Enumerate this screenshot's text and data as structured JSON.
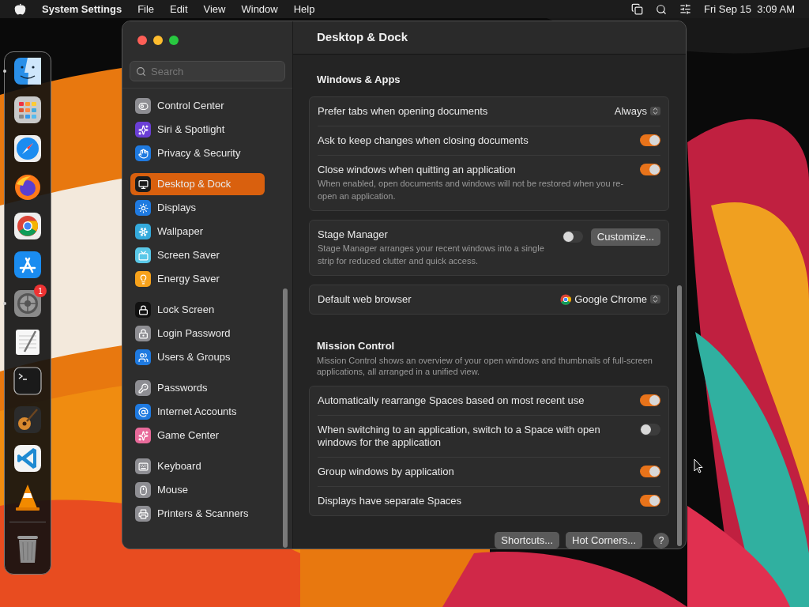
{
  "menubar": {
    "app_name": "System Settings",
    "menus": [
      "File",
      "Edit",
      "View",
      "Window",
      "Help"
    ],
    "clock": "Fri Sep 15  3:09 AM"
  },
  "dock": {
    "items": [
      {
        "kind": "finder",
        "running": true
      },
      {
        "kind": "launchpad",
        "running": false
      },
      {
        "kind": "safari",
        "running": false
      },
      {
        "kind": "firefox",
        "running": false
      },
      {
        "kind": "chrome",
        "running": false
      },
      {
        "kind": "appstore",
        "running": false
      },
      {
        "kind": "settings",
        "running": true,
        "badge": "1"
      },
      {
        "kind": "textedit",
        "running": false
      },
      {
        "kind": "terminal",
        "running": false
      },
      {
        "kind": "guitar",
        "running": false
      },
      {
        "kind": "vscode",
        "running": false
      },
      {
        "kind": "vlc",
        "running": false
      },
      {
        "kind": "trash",
        "running": false
      }
    ]
  },
  "sidebar": {
    "search": {
      "placeholder": "Search"
    },
    "groups": [
      [
        {
          "label": "Control Center",
          "kind": "controls",
          "selected": false
        },
        {
          "label": "Siri & Spotlight",
          "kind": "siri",
          "selected": false
        },
        {
          "label": "Privacy & Security",
          "kind": "privacy",
          "selected": false
        }
      ],
      [
        {
          "label": "Desktop & Dock",
          "kind": "desktop",
          "selected": true
        },
        {
          "label": "Displays",
          "kind": "displays",
          "selected": false
        },
        {
          "label": "Wallpaper",
          "kind": "wallpaper",
          "selected": false
        },
        {
          "label": "Screen Saver",
          "kind": "screensaver",
          "selected": false
        },
        {
          "label": "Energy Saver",
          "kind": "energy",
          "selected": false
        }
      ],
      [
        {
          "label": "Lock Screen",
          "kind": "lock",
          "selected": false
        },
        {
          "label": "Login Password",
          "kind": "login",
          "selected": false
        },
        {
          "label": "Users & Groups",
          "kind": "users",
          "selected": false
        }
      ],
      [
        {
          "label": "Passwords",
          "kind": "passwords",
          "selected": false
        },
        {
          "label": "Internet Accounts",
          "kind": "internet",
          "selected": false
        },
        {
          "label": "Game Center",
          "kind": "gamecenter",
          "selected": false
        }
      ],
      [
        {
          "label": "Keyboard",
          "kind": "keyboard",
          "selected": false
        },
        {
          "label": "Mouse",
          "kind": "mouse",
          "selected": false
        },
        {
          "label": "Printers & Scanners",
          "kind": "printers",
          "selected": false
        }
      ]
    ]
  },
  "main": {
    "title": "Desktop & Dock",
    "sections": [
      {
        "heading": "Windows & Apps",
        "cards": [
          [
            {
              "kind": "select",
              "label": "Prefer tabs when opening documents",
              "value": "Always"
            },
            {
              "kind": "toggle",
              "label": "Ask to keep changes when closing documents",
              "on": true
            },
            {
              "kind": "toggle",
              "label": "Close windows when quitting an application",
              "description": "When enabled, open documents and windows will not be restored when you re-open an application.",
              "on": true
            }
          ],
          [
            {
              "kind": "toggle_button",
              "label": "Stage Manager",
              "description": "Stage Manager arranges your recent windows into a single strip for reduced clutter and quick access.",
              "on": false,
              "button": "Customize..."
            }
          ],
          [
            {
              "kind": "browser",
              "label": "Default web browser",
              "value": "Google Chrome"
            }
          ]
        ]
      },
      {
        "heading": "Mission Control",
        "description": "Mission Control shows an overview of your open windows and thumbnails of full-screen applications, all arranged in a unified view.",
        "cards": [
          [
            {
              "kind": "toggle",
              "label": "Automatically rearrange Spaces based on most recent use",
              "on": true
            },
            {
              "kind": "toggle",
              "label": "When switching to an application, switch to a Space with open windows for the application",
              "on": false
            },
            {
              "kind": "toggle",
              "label": "Group windows by application",
              "on": true
            },
            {
              "kind": "toggle",
              "label": "Displays have separate Spaces",
              "on": true
            }
          ]
        ]
      }
    ],
    "buttons": [
      "Shortcuts...",
      "Hot Corners..."
    ],
    "help": "?"
  }
}
